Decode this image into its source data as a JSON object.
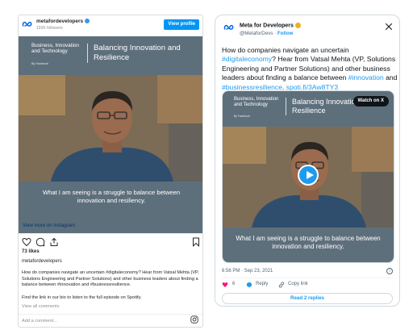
{
  "instagram": {
    "username": "metafordevelopers",
    "followers": "193K followers",
    "view_profile": "View profile",
    "view_more": "View more on Instagram",
    "likes": "73 likes",
    "author": "metafordevelopers",
    "caption": "How do companies navigate an uncertain #digitaleconomy? Hear from Vatsal Mehta (VP, Solutions Engineering and Partner Solutions) and other business leaders about finding a balance between #innovation and #businessresilience.",
    "caption_link": "Find the link in our bio to listen to the full episode on Spotify.",
    "view_comments": "View all comments",
    "add_comment": "Add a comment..."
  },
  "media": {
    "series": "Business, Innovation and Technology",
    "byline": "By Facebook",
    "title": "Balancing Innovation and Resilience",
    "quote": "What I am seeing is a struggle to balance between innovation and resiliency."
  },
  "twitter": {
    "name": "Meta for Developers",
    "handle": "@MetaforDevs",
    "follow": "Follow",
    "text_pre": "How do companies navigate an uncertain ",
    "hashtag1": "#digitaleconomy",
    "text_mid": "? Hear from Vatsal Mehta (VP, Solutions Engineering and Partner Solutions) and other business leaders about finding a balance between ",
    "hashtag2": "#innovation",
    "text_and": " and ",
    "hashtag3": "#businessresilience",
    "text_dot": ". ",
    "link": "spoti.fi/3Aw8TY3",
    "watch": "Watch on X",
    "time": "6:56 PM · Sep 23, 2021",
    "likes": "6",
    "reply": "Reply",
    "copy_link": "Copy link",
    "read_replies": "Read 2 replies"
  },
  "colors": {
    "ig_blue": "#0095f6",
    "tw_blue": "#1d9bf0",
    "media_slate": "#5e6f7c",
    "heart": "#f91880"
  }
}
